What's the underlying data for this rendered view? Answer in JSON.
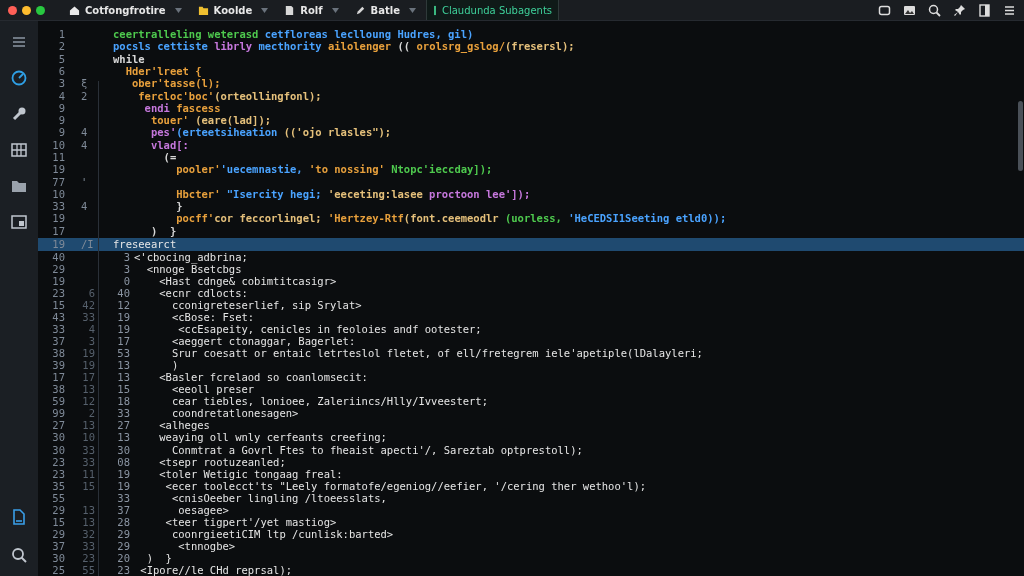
{
  "tabs": [
    {
      "label": "Cotfongfrotire",
      "kind": "house",
      "selected": false
    },
    {
      "label": "Koolde",
      "kind": "folder",
      "selected": false
    },
    {
      "label": "Rolf",
      "kind": "file",
      "selected": false
    },
    {
      "label": "Batle",
      "kind": "pen",
      "selected": false
    },
    {
      "label": "Claudunda Subagents",
      "kind": "bar",
      "selected": true
    }
  ],
  "editor": {
    "upper_lines": [
      {
        "number": "1",
        "segments": [
          {
            "text": "ceertralleling weterasd ",
            "color": "#4ec94e"
          },
          {
            "text": "cetfloreas leclloung Hudres, gil)",
            "color": "#4aa3ff"
          }
        ]
      },
      {
        "number": "2",
        "segments": [
          {
            "text": "pocsls cettiste ",
            "color": "#4aa3ff"
          },
          {
            "text": "librly ",
            "color": "#c678dd"
          },
          {
            "text": "mecthority ",
            "color": "#4aa3ff"
          },
          {
            "text": "ailolenger ",
            "color": "#e8a03c"
          },
          {
            "text": "(( ",
            "color": "#d8d8d8"
          },
          {
            "text": "orolsrg_gslog/",
            "color": "#e8a03c"
          },
          {
            "text": "(fresersl);",
            "color": "#e5c07b"
          }
        ]
      },
      {
        "number": "5",
        "segments": [
          {
            "text": "while",
            "color": "#d8d8d8"
          }
        ]
      },
      {
        "number": "6",
        "segments": [
          {
            "text": "  Hder'lreet {",
            "color": "#e8a03c"
          }
        ]
      },
      {
        "number": "3",
        "marker": "ξ",
        "segments": [
          {
            "text": "   ober'tasse(l);",
            "color": "#e8a03c"
          }
        ]
      },
      {
        "number": "4",
        "marker": "2",
        "segments": [
          {
            "text": "    fercloc'boc'",
            "color": "#e8a03c"
          },
          {
            "text": "(orteollingfonl);",
            "color": "#e5c07b"
          }
        ]
      },
      {
        "number": "9",
        "segments": [
          {
            "text": "     endi ",
            "color": "#c678dd"
          },
          {
            "text": "fascess",
            "color": "#e8a03c"
          }
        ]
      },
      {
        "number": "9",
        "segments": [
          {
            "text": "      touer' ",
            "color": "#e8a03c"
          },
          {
            "text": "(eare(lad]);",
            "color": "#e5c07b"
          }
        ]
      },
      {
        "number": "9",
        "marker": "4",
        "segments": [
          {
            "text": "      pes'",
            "color": "#c678dd"
          },
          {
            "text": "(erteetsiheation ",
            "color": "#4aa3ff"
          },
          {
            "text": "(('ojo rlasles\");",
            "color": "#e5c07b"
          }
        ]
      },
      {
        "number": "10",
        "marker": "4",
        "segments": [
          {
            "text": "      vlad[:",
            "color": "#c678dd"
          }
        ]
      },
      {
        "number": "11",
        "segments": [
          {
            "text": "        (=",
            "color": "#d8d8d8"
          }
        ]
      },
      {
        "number": "19",
        "segments": [
          {
            "text": "          pooler'",
            "color": "#e8a03c"
          },
          {
            "text": "'uecemnastie, ",
            "color": "#4aa3ff"
          },
          {
            "text": "'to nossing' ",
            "color": "#e8a03c"
          },
          {
            "text": "Ntopc'ieccday]);",
            "color": "#4ec94e"
          }
        ]
      },
      {
        "number": "77",
        "marker": "'"
      },
      {
        "number": "10",
        "segments": [
          {
            "text": "          Hbcter' ",
            "color": "#e8a03c"
          },
          {
            "text": "\"Isercity hegi; ",
            "color": "#4aa3ff"
          },
          {
            "text": "'eeceting:lasee ",
            "color": "#e5c07b"
          },
          {
            "text": "proctoon lee']);",
            "color": "#c678dd"
          }
        ]
      },
      {
        "number": "33",
        "marker": "4",
        "segments": [
          {
            "text": "          }",
            "color": "#d8d8d8"
          }
        ]
      },
      {
        "number": "19",
        "segments": [
          {
            "text": "          pocff'",
            "color": "#e8a03c"
          },
          {
            "text": "cor feccorlingel; ",
            "color": "#e5c07b"
          },
          {
            "text": "'Hertzey-Rtf",
            "color": "#e8a03c"
          },
          {
            "text": "(font.ceemeodlr ",
            "color": "#e5c07b"
          },
          {
            "text": "(uorless, ",
            "color": "#4ec94e"
          },
          {
            "text": "'HeCEDSI1Seeting etld0));",
            "color": "#4aa3ff"
          }
        ]
      },
      {
        "number": "17",
        "segments": [
          {
            "text": "      )  }",
            "color": "#d8d8d8"
          }
        ]
      }
    ],
    "current_line": {
      "number": "19",
      "marker": "/I",
      "text": "freseearct"
    },
    "lower_lines": [
      {
        "columns": [
          "40",
          "3"
        ],
        "text": "<'cbocing_adbrina;"
      },
      {
        "columns": [
          "29",
          "3"
        ],
        "text": "  <nnoge Bsetcbgs"
      },
      {
        "columns": [
          "19",
          "0"
        ],
        "text": "    <Hast cdnge& cobimtitcasigr>"
      },
      {
        "columns": [
          "23",
          "6",
          "40"
        ],
        "text": "    <ecnr cdlocts:"
      },
      {
        "columns": [
          "15",
          "42",
          "12"
        ],
        "text": "      cconigreteserlief, sip Srylat>"
      },
      {
        "columns": [
          "43",
          "33",
          "19"
        ],
        "text": "      <cBose: Fset:"
      },
      {
        "columns": [
          "33",
          "4",
          "19"
        ],
        "text": "       <ccEsapeity, cenicles in feoloies andf ootester;"
      },
      {
        "columns": [
          "37",
          "3",
          "17"
        ],
        "text": "      <aeggert ctonaggar, Bagerlet:"
      },
      {
        "columns": [
          "38",
          "19",
          "53"
        ],
        "text": "      Srur coesatt or entaic letrteslol fletet, of ell/fretegrem iele'apetiple(lDalayleri;"
      },
      {
        "columns": [
          "39",
          "19",
          "13"
        ],
        "text": "      )"
      },
      {
        "columns": [
          "17",
          "17",
          "13"
        ],
        "text": "    <Basler fcrelaod so coanlomsecit:"
      },
      {
        "columns": [
          "38",
          "13",
          "15"
        ],
        "text": "      <eeoll preser"
      },
      {
        "columns": [
          "59",
          "12",
          "18"
        ],
        "text": "      cear tiebles, lonioee, Zaleriincs/Hlly/Ivveestert;"
      },
      {
        "columns": [
          "99",
          "2",
          "33"
        ],
        "text": "      coondretatlonesagen>"
      },
      {
        "columns": [
          "27",
          "13",
          "27"
        ],
        "text": "    <alheges"
      },
      {
        "columns": [
          "30",
          "10",
          "13"
        ],
        "text": "    weaying oll wnly cerfeants creefing;"
      },
      {
        "columns": [
          "30",
          "33",
          "30"
        ],
        "text": "      Conmtrat a Govrl Ftes to fheaist apecti'/, Sareztab optprestoll);"
      },
      {
        "columns": [
          "23",
          "33",
          "08"
        ],
        "text": "    <tsepr rootuzeanled;"
      },
      {
        "columns": [
          "23",
          "11",
          "19"
        ],
        "text": "    <toler Wetigic tongaag freal:"
      },
      {
        "columns": [
          "35",
          "15",
          "19"
        ],
        "text": "     <ecer toolecct'ts \"Leely formatofe/egeniog//eefier, '/cering ther wethoo'l);"
      },
      {
        "columns": [
          "55",
          "33"
        ],
        "text": "      <cnisOeeber lingling /ltoeesslats,"
      },
      {
        "columns": [
          "29",
          "13",
          "37"
        ],
        "text": "       oesagee>"
      },
      {
        "columns": [
          "15",
          "13",
          "28"
        ],
        "text": "     <teer tigpert'/yet mastiog>"
      },
      {
        "columns": [
          "29",
          "32",
          "29"
        ],
        "text": "      coonrgieetiCIM ltp /cunlisk:barted>"
      },
      {
        "columns": [
          "37",
          "33",
          "29"
        ],
        "text": "       <tnnogbe>"
      },
      {
        "columns": [
          "30",
          "23",
          "20"
        ],
        "text": "  )  }"
      },
      {
        "columns": [
          "25",
          "55",
          "23"
        ],
        "text": " <Ipore//le CHd reprsal);"
      }
    ]
  }
}
